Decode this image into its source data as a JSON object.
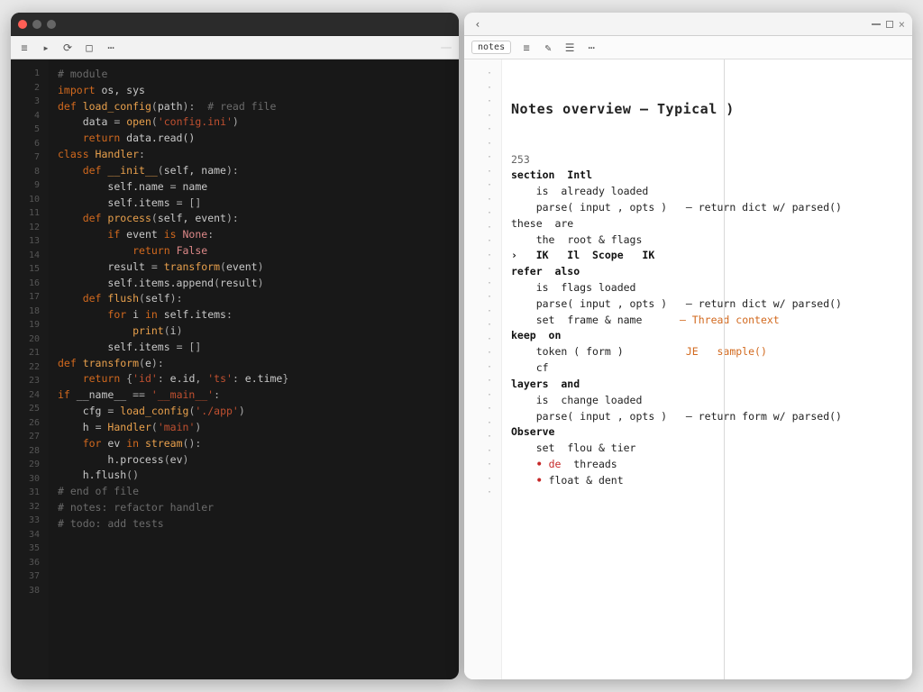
{
  "left_pane": {
    "title": "",
    "toolbar_items": [
      "≡",
      "▸",
      "⟳",
      "□",
      "⋯"
    ],
    "search_badge": "",
    "gutter": [
      "1",
      "2",
      "3",
      "4",
      "5",
      "6",
      "7",
      "8",
      "9",
      "10",
      "11",
      "12",
      "13",
      "14",
      "15",
      "16",
      "17",
      "18",
      "19",
      "20",
      "21",
      "22",
      "23",
      "24",
      "25",
      "26",
      "27",
      "28",
      "29",
      "30",
      "31",
      "32",
      "33",
      "34",
      "35",
      "36",
      "37",
      "38"
    ],
    "lines": [
      {
        "indent": 0,
        "spans": [
          {
            "c": "d-cm",
            "t": "# module"
          }
        ]
      },
      {
        "indent": 0,
        "spans": [
          {
            "c": "d-kw",
            "t": "import"
          },
          {
            "c": "d-id",
            "t": " os, sys"
          }
        ]
      },
      {
        "indent": 0,
        "spans": []
      },
      {
        "indent": 0,
        "spans": [
          {
            "c": "d-kw",
            "t": "def "
          },
          {
            "c": "d-fn",
            "t": "load_config"
          },
          {
            "c": "d-op",
            "t": "("
          },
          {
            "c": "d-id",
            "t": "path"
          },
          {
            "c": "d-op",
            "t": "):"
          },
          {
            "c": "d-cm",
            "t": "  # read file"
          }
        ]
      },
      {
        "indent": 1,
        "spans": [
          {
            "c": "d-id",
            "t": "data "
          },
          {
            "c": "d-op",
            "t": "= "
          },
          {
            "c": "d-fn",
            "t": "open"
          },
          {
            "c": "d-op",
            "t": "("
          },
          {
            "c": "d-str",
            "t": "'config.ini'"
          },
          {
            "c": "d-op",
            "t": ")"
          }
        ]
      },
      {
        "indent": 1,
        "spans": [
          {
            "c": "d-kw",
            "t": "return "
          },
          {
            "c": "d-id",
            "t": "data.read()"
          }
        ]
      },
      {
        "indent": 0,
        "spans": []
      },
      {
        "indent": 0,
        "spans": [
          {
            "c": "d-kw",
            "t": "class "
          },
          {
            "c": "d-fn",
            "t": "Handler"
          },
          {
            "c": "d-op",
            "t": ":"
          }
        ]
      },
      {
        "indent": 1,
        "spans": [
          {
            "c": "d-kw",
            "t": "def "
          },
          {
            "c": "d-fn",
            "t": "__init__"
          },
          {
            "c": "d-op",
            "t": "("
          },
          {
            "c": "d-id",
            "t": "self, name"
          },
          {
            "c": "d-op",
            "t": "):"
          }
        ]
      },
      {
        "indent": 2,
        "spans": [
          {
            "c": "d-id",
            "t": "self.name "
          },
          {
            "c": "d-op",
            "t": "= "
          },
          {
            "c": "d-id",
            "t": "name"
          }
        ]
      },
      {
        "indent": 2,
        "spans": [
          {
            "c": "d-id",
            "t": "self.items "
          },
          {
            "c": "d-op",
            "t": "= "
          },
          {
            "c": "d-op",
            "t": "[]"
          }
        ]
      },
      {
        "indent": 0,
        "spans": []
      },
      {
        "indent": 1,
        "spans": [
          {
            "c": "d-kw",
            "t": "def "
          },
          {
            "c": "d-fn",
            "t": "process"
          },
          {
            "c": "d-op",
            "t": "("
          },
          {
            "c": "d-id",
            "t": "self, event"
          },
          {
            "c": "d-op",
            "t": "):"
          }
        ]
      },
      {
        "indent": 2,
        "spans": [
          {
            "c": "d-kw",
            "t": "if "
          },
          {
            "c": "d-id",
            "t": "event "
          },
          {
            "c": "d-kw",
            "t": "is "
          },
          {
            "c": "d-num",
            "t": "None"
          },
          {
            "c": "d-op",
            "t": ":"
          }
        ]
      },
      {
        "indent": 3,
        "spans": [
          {
            "c": "d-kw",
            "t": "return "
          },
          {
            "c": "d-num",
            "t": "False"
          }
        ]
      },
      {
        "indent": 2,
        "spans": [
          {
            "c": "d-id",
            "t": "result "
          },
          {
            "c": "d-op",
            "t": "= "
          },
          {
            "c": "d-fn",
            "t": "transform"
          },
          {
            "c": "d-op",
            "t": "("
          },
          {
            "c": "d-id",
            "t": "event"
          },
          {
            "c": "d-op",
            "t": ")"
          }
        ]
      },
      {
        "indent": 2,
        "spans": [
          {
            "c": "d-id",
            "t": "self.items.append"
          },
          {
            "c": "d-op",
            "t": "("
          },
          {
            "c": "d-id",
            "t": "result"
          },
          {
            "c": "d-op",
            "t": ")"
          }
        ]
      },
      {
        "indent": 0,
        "spans": []
      },
      {
        "indent": 1,
        "spans": [
          {
            "c": "d-kw",
            "t": "def "
          },
          {
            "c": "d-fn",
            "t": "flush"
          },
          {
            "c": "d-op",
            "t": "("
          },
          {
            "c": "d-id",
            "t": "self"
          },
          {
            "c": "d-op",
            "t": "):"
          }
        ]
      },
      {
        "indent": 2,
        "spans": [
          {
            "c": "d-kw",
            "t": "for "
          },
          {
            "c": "d-id",
            "t": "i "
          },
          {
            "c": "d-kw",
            "t": "in "
          },
          {
            "c": "d-id",
            "t": "self.items"
          },
          {
            "c": "d-op",
            "t": ":"
          }
        ]
      },
      {
        "indent": 3,
        "spans": [
          {
            "c": "d-fn",
            "t": "print"
          },
          {
            "c": "d-op",
            "t": "("
          },
          {
            "c": "d-id",
            "t": "i"
          },
          {
            "c": "d-op",
            "t": ")"
          }
        ]
      },
      {
        "indent": 2,
        "spans": [
          {
            "c": "d-id",
            "t": "self.items "
          },
          {
            "c": "d-op",
            "t": "= "
          },
          {
            "c": "d-op",
            "t": "[]"
          }
        ]
      },
      {
        "indent": 0,
        "spans": []
      },
      {
        "indent": 0,
        "spans": [
          {
            "c": "d-kw",
            "t": "def "
          },
          {
            "c": "d-fn",
            "t": "transform"
          },
          {
            "c": "d-op",
            "t": "("
          },
          {
            "c": "d-id",
            "t": "e"
          },
          {
            "c": "d-op",
            "t": "):"
          }
        ]
      },
      {
        "indent": 1,
        "spans": [
          {
            "c": "d-kw",
            "t": "return "
          },
          {
            "c": "d-op",
            "t": "{"
          },
          {
            "c": "d-str",
            "t": "'id'"
          },
          {
            "c": "d-op",
            "t": ": "
          },
          {
            "c": "d-id",
            "t": "e.id"
          },
          {
            "c": "d-op",
            "t": ", "
          },
          {
            "c": "d-str",
            "t": "'ts'"
          },
          {
            "c": "d-op",
            "t": ": "
          },
          {
            "c": "d-id",
            "t": "e.time"
          },
          {
            "c": "d-op",
            "t": "}"
          }
        ]
      },
      {
        "indent": 0,
        "spans": []
      },
      {
        "indent": 0,
        "spans": [
          {
            "c": "d-kw",
            "t": "if "
          },
          {
            "c": "d-id",
            "t": "__name__ "
          },
          {
            "c": "d-op",
            "t": "== "
          },
          {
            "c": "d-str",
            "t": "'__main__'"
          },
          {
            "c": "d-op",
            "t": ":"
          }
        ]
      },
      {
        "indent": 1,
        "spans": [
          {
            "c": "d-id",
            "t": "cfg "
          },
          {
            "c": "d-op",
            "t": "= "
          },
          {
            "c": "d-fn",
            "t": "load_config"
          },
          {
            "c": "d-op",
            "t": "("
          },
          {
            "c": "d-str",
            "t": "'./app'"
          },
          {
            "c": "d-op",
            "t": ")"
          }
        ]
      },
      {
        "indent": 1,
        "spans": [
          {
            "c": "d-id",
            "t": "h "
          },
          {
            "c": "d-op",
            "t": "= "
          },
          {
            "c": "d-fn",
            "t": "Handler"
          },
          {
            "c": "d-op",
            "t": "("
          },
          {
            "c": "d-str",
            "t": "'main'"
          },
          {
            "c": "d-op",
            "t": ")"
          }
        ]
      },
      {
        "indent": 1,
        "spans": [
          {
            "c": "d-kw",
            "t": "for "
          },
          {
            "c": "d-id",
            "t": "ev "
          },
          {
            "c": "d-kw",
            "t": "in "
          },
          {
            "c": "d-fn",
            "t": "stream"
          },
          {
            "c": "d-op",
            "t": "():"
          }
        ]
      },
      {
        "indent": 2,
        "spans": [
          {
            "c": "d-id",
            "t": "h.process"
          },
          {
            "c": "d-op",
            "t": "("
          },
          {
            "c": "d-id",
            "t": "ev"
          },
          {
            "c": "d-op",
            "t": ")"
          }
        ]
      },
      {
        "indent": 1,
        "spans": [
          {
            "c": "d-id",
            "t": "h.flush"
          },
          {
            "c": "d-op",
            "t": "()"
          }
        ]
      },
      {
        "indent": 0,
        "spans": []
      },
      {
        "indent": 0,
        "spans": [
          {
            "c": "d-cm",
            "t": "# end of file"
          }
        ]
      },
      {
        "indent": 0,
        "spans": [
          {
            "c": "d-cm",
            "t": "# notes: refactor handler"
          }
        ]
      },
      {
        "indent": 0,
        "spans": [
          {
            "c": "d-cm",
            "t": "# todo: add tests"
          }
        ]
      },
      {
        "indent": 0,
        "spans": []
      },
      {
        "indent": 0,
        "spans": []
      }
    ]
  },
  "right_pane": {
    "tab_active": "notes",
    "heading": "Notes overview — Typical )",
    "toolbar_items": [
      "‹",
      "≡",
      "✎",
      "☰",
      "⋯"
    ],
    "gutter": [
      "·",
      "·",
      "·",
      "·",
      "·",
      "·",
      "·",
      "·",
      "·",
      "·",
      "·",
      "·",
      "·",
      "·",
      "·",
      "·",
      "·",
      "·",
      "·",
      "·",
      "·",
      "·",
      "·",
      "·",
      "·",
      "·",
      "·",
      "·",
      "·",
      "·",
      "·"
    ],
    "lines": [
      {
        "indent": 0,
        "spans": [
          {
            "c": "",
            "t": ""
          }
        ]
      },
      {
        "indent": 0,
        "spans": [
          {
            "c": "l-dim",
            "t": "253"
          }
        ]
      },
      {
        "indent": 0,
        "spans": [
          {
            "c": "l-kw",
            "t": "section  Intl"
          }
        ]
      },
      {
        "indent": 1,
        "spans": [
          {
            "c": "",
            "t": "is  already loaded"
          }
        ]
      },
      {
        "indent": 1,
        "spans": [
          {
            "c": "",
            "t": "parse( input , opts )   — return dict w/ parsed()"
          }
        ]
      },
      {
        "indent": 0,
        "spans": [
          {
            "c": "",
            "t": "these  are"
          }
        ]
      },
      {
        "indent": 1,
        "spans": [
          {
            "c": "",
            "t": "the  root & flags"
          }
        ]
      },
      {
        "indent": 0,
        "spans": [
          {
            "c": "",
            "t": ""
          }
        ]
      },
      {
        "indent": 0,
        "spans": [
          {
            "c": "l-kw",
            "t": "›   IK   Il  Scope   IK"
          }
        ]
      },
      {
        "indent": 0,
        "spans": [
          {
            "c": "",
            "t": ""
          }
        ]
      },
      {
        "indent": 0,
        "spans": [
          {
            "c": "l-kw",
            "t": "refer  also"
          }
        ]
      },
      {
        "indent": 1,
        "spans": [
          {
            "c": "",
            "t": "is  flags loaded"
          }
        ]
      },
      {
        "indent": 1,
        "spans": [
          {
            "c": "",
            "t": "parse( input , opts )   — return dict w/ parsed()"
          }
        ]
      },
      {
        "indent": 1,
        "spans": [
          {
            "c": "",
            "t": "set  frame & name      "
          },
          {
            "c": "l-acc",
            "t": "— Thread context"
          }
        ]
      },
      {
        "indent": 0,
        "spans": [
          {
            "c": "l-kw",
            "t": "keep  on"
          }
        ]
      },
      {
        "indent": 1,
        "spans": [
          {
            "c": "",
            "t": "token ( form )          "
          },
          {
            "c": "l-acc",
            "t": "JE   sample()"
          }
        ]
      },
      {
        "indent": 1,
        "spans": [
          {
            "c": "",
            "t": "cf"
          }
        ]
      },
      {
        "indent": 0,
        "spans": [
          {
            "c": "l-kw",
            "t": "layers  and"
          }
        ]
      },
      {
        "indent": 1,
        "spans": [
          {
            "c": "",
            "t": "is  change loaded"
          }
        ]
      },
      {
        "indent": 1,
        "spans": [
          {
            "c": "",
            "t": "parse( input , opts )   — return form w/ parsed()"
          }
        ]
      },
      {
        "indent": 0,
        "spans": [
          {
            "c": "l-kw",
            "t": "Observe"
          }
        ]
      },
      {
        "indent": 1,
        "spans": [
          {
            "c": "",
            "t": "set  flou & tier"
          }
        ]
      },
      {
        "indent": 1,
        "spans": [
          {
            "c": "bullet",
            "t": "• "
          },
          {
            "c": "l-red",
            "t": "de"
          },
          {
            "c": "",
            "t": "  threads"
          }
        ]
      },
      {
        "indent": 1,
        "spans": [
          {
            "c": "bullet",
            "t": "• "
          },
          {
            "c": "",
            "t": "float & dent"
          }
        ]
      },
      {
        "indent": 0,
        "spans": []
      },
      {
        "indent": 0,
        "spans": []
      },
      {
        "indent": 0,
        "spans": []
      },
      {
        "indent": 0,
        "spans": []
      },
      {
        "indent": 0,
        "spans": []
      },
      {
        "indent": 0,
        "spans": []
      },
      {
        "indent": 0,
        "spans": []
      }
    ]
  }
}
